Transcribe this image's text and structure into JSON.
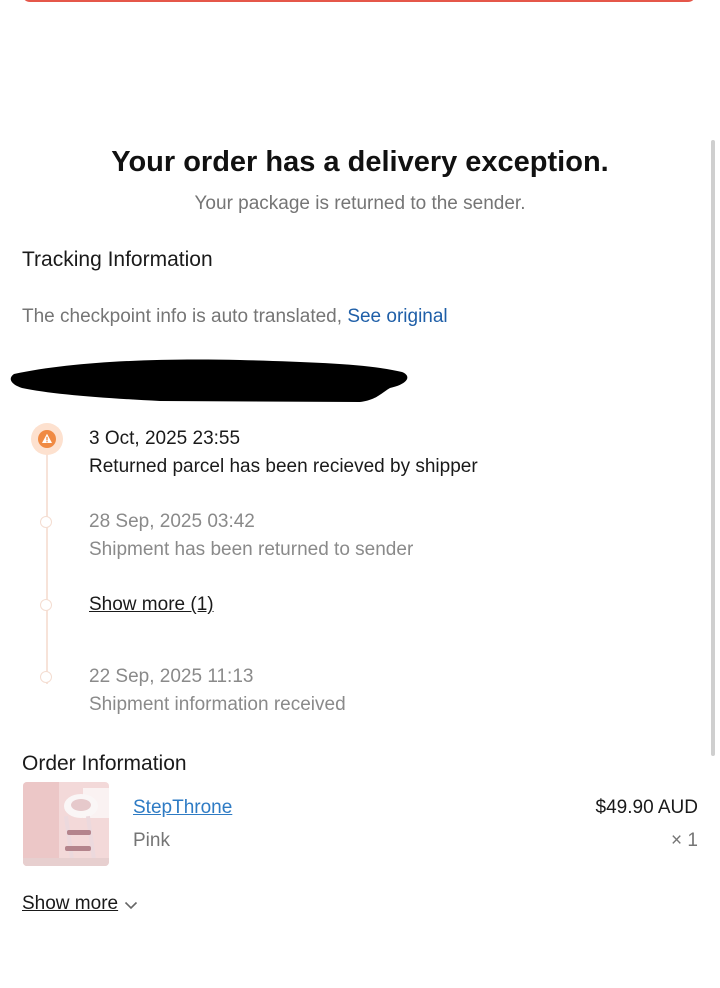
{
  "header": {
    "title": "Your order has a delivery exception.",
    "subtitle": "Your package is returned to the sender."
  },
  "tracking": {
    "section_title": "Tracking Information",
    "translate_note": "The checkpoint info is auto translated,",
    "see_original": "See original",
    "events": [
      {
        "date": "3 Oct, 2025 23:55",
        "description": "Returned parcel has been recieved by shipper",
        "icon": "warning-icon"
      },
      {
        "date": "28 Sep, 2025 03:42",
        "description": "Shipment has been returned to sender"
      },
      {
        "date": "22 Sep, 2025 11:13",
        "description": "Shipment information received"
      }
    ],
    "show_more": "Show more (1)"
  },
  "order": {
    "section_title": "Order Information",
    "product": {
      "name": "StepThrone",
      "variant": "Pink",
      "price": "$49.90 AUD",
      "quantity": "× 1"
    },
    "show_more": "Show more"
  },
  "colors": {
    "accent_link": "#1f5fa8",
    "product_link": "#2e7bc4",
    "warning_badge": "#f08a43",
    "top_button": "#e5574a"
  }
}
